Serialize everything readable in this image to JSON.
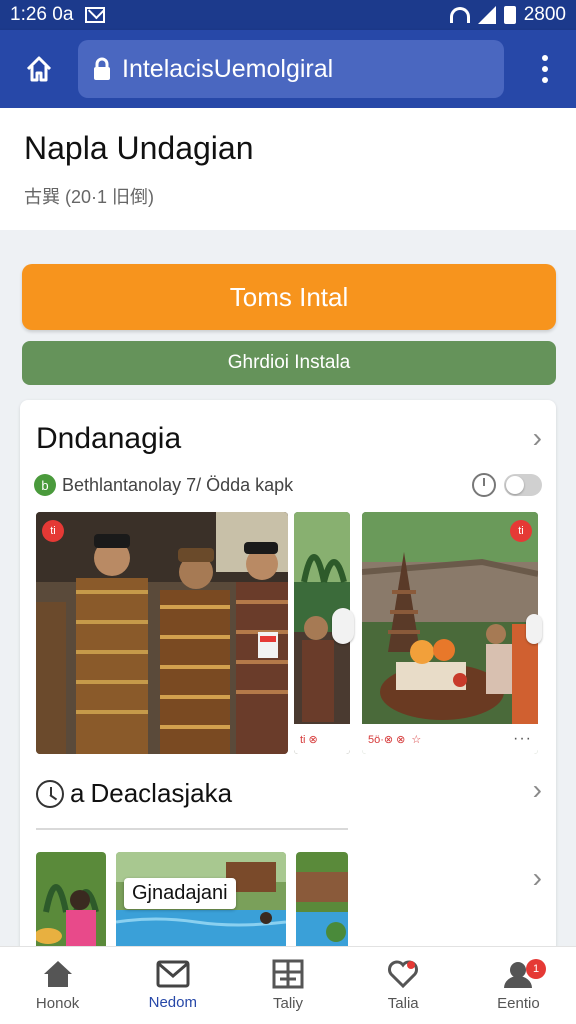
{
  "status_bar": {
    "time": "1:26 0a",
    "battery": "2800"
  },
  "app_bar": {
    "url": "IntelacisUemolgiral"
  },
  "header": {
    "title": "Napla Undagian",
    "subtitle": "古巽 (20·1 旧倒)"
  },
  "actions": {
    "primary_label": "Toms Intal",
    "secondary_label": "Ghrdioi Instala"
  },
  "card": {
    "title": "Dndanagia",
    "meta_icon_label": "b",
    "meta_text": "Bethlantanolay 7/ Ödda kapk",
    "thumb_badge_left": "ti",
    "thumb_badge_right": "ti",
    "thumb_footer_mid": "ti ⊗",
    "thumb_footer_right": "5ö·⊗ ⊗",
    "section_title": "Deaclasjaka",
    "section_prefix": "a",
    "overlay_label": "Gjnadajani"
  },
  "bottom_nav": [
    {
      "label": "Honok",
      "icon": "home-icon"
    },
    {
      "label": "Nedom",
      "icon": "mail-icon",
      "active": true
    },
    {
      "label": "Taliy",
      "icon": "grid-icon"
    },
    {
      "label": "Talia",
      "icon": "heart-icon"
    },
    {
      "label": "Eentio",
      "icon": "profile-icon",
      "badge": "1"
    }
  ],
  "colors": {
    "status_bar": "#1c3a8c",
    "app_bar": "#2748a8",
    "primary_button": "#f7941d",
    "secondary_button": "#65935a",
    "nav_active": "#2748a8"
  }
}
